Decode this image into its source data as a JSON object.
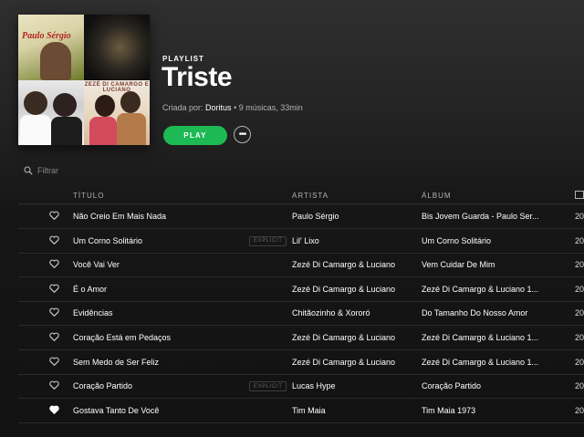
{
  "cover": {
    "tiles": [
      {
        "title": "Paulo Sérgio"
      },
      {
        "title": ""
      },
      {
        "title": ""
      },
      {
        "title": "ZEZÉ DI CAMARGO E LUCIANO"
      }
    ]
  },
  "header": {
    "kind": "PLAYLIST",
    "title": "Triste",
    "created_by_label": "Criada por:",
    "owner": "Doritus",
    "summary": " • 9 músicas, 33min",
    "play_label": "PLAY",
    "more_label": "•••"
  },
  "filter": {
    "placeholder": "Filtrar",
    "value": ""
  },
  "table": {
    "headers": {
      "title": "TÍTULO",
      "artist": "ARTISTA",
      "album": "ÁLBUM",
      "date_icon": "calendar-icon"
    },
    "explicit_label": "EXPLICIT",
    "rows": [
      {
        "title": "Não Creio Em Mais Nada",
        "artist": "Paulo Sérgio",
        "album": "Bis Jovem Guarda - Paulo Ser...",
        "date": "20",
        "explicit": false,
        "liked": false
      },
      {
        "title": "Um Corno Solitário",
        "artist": "Lil' Lixo",
        "album": "Um Corno Solitário",
        "date": "20",
        "explicit": true,
        "liked": false
      },
      {
        "title": "Você Vai Ver",
        "artist": "Zezé Di Camargo & Luciano",
        "album": "Vem Cuidar De Mim",
        "date": "20",
        "explicit": false,
        "liked": false
      },
      {
        "title": "É o Amor",
        "artist": "Zezé Di Camargo & Luciano",
        "album": "Zezé Di Camargo & Luciano 1...",
        "date": "20",
        "explicit": false,
        "liked": false
      },
      {
        "title": "Evidências",
        "artist": "Chitãozinho & Xororó",
        "album": "Do Tamanho Do Nosso Amor",
        "date": "20",
        "explicit": false,
        "liked": false
      },
      {
        "title": "Coração Está em Pedaços",
        "artist": "Zezé Di Camargo & Luciano",
        "album": "Zezé Di Camargo & Luciano 1...",
        "date": "20",
        "explicit": false,
        "liked": false
      },
      {
        "title": "Sem Medo de Ser Feliz",
        "artist": "Zezé Di Camargo & Luciano",
        "album": "Zezé Di Camargo & Luciano 1...",
        "date": "20",
        "explicit": false,
        "liked": false
      },
      {
        "title": "Coração Partido",
        "artist": "Lucas Hype",
        "album": "Coração Partido",
        "date": "20",
        "explicit": true,
        "liked": false
      },
      {
        "title": "Gostava Tanto De Você",
        "artist": "Tim Maia",
        "album": "Tim Maia 1973",
        "date": "20",
        "explicit": false,
        "liked": true
      }
    ]
  },
  "colors": {
    "accent": "#1db954",
    "text_muted": "#b3b3b3",
    "background": "#121212"
  }
}
